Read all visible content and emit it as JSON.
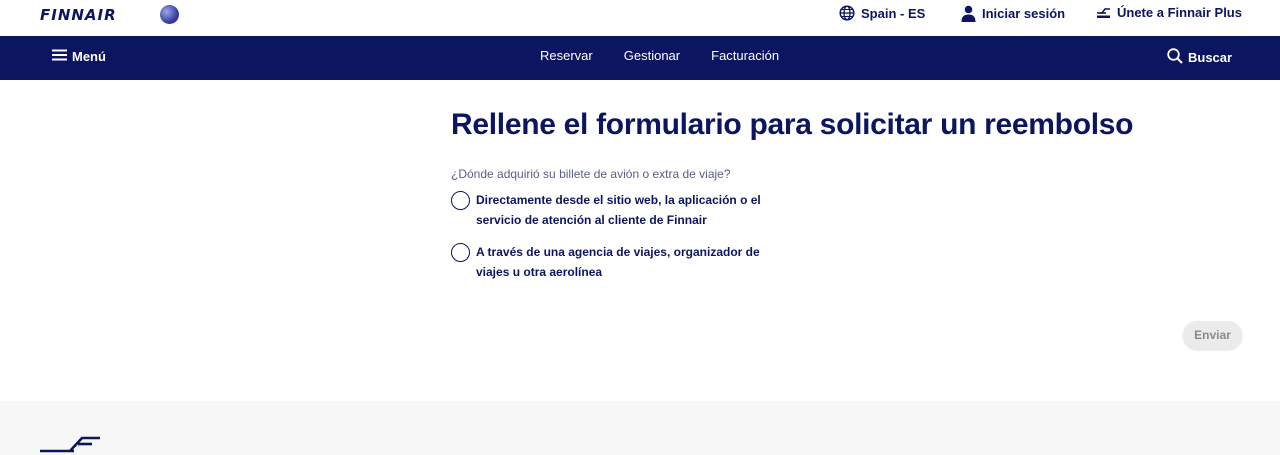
{
  "header": {
    "brand": "FINNAIR",
    "language_label": "Spain - ES",
    "login_label": "Iniciar sesión",
    "plus_label": "Únete a Finnair Plus"
  },
  "nav": {
    "menu_label": "Menú",
    "links": [
      "Reservar",
      "Gestionar",
      "Facturación"
    ],
    "search_label": "Buscar"
  },
  "form": {
    "title": "Rellene el formulario para solicitar un reembolso",
    "question": "¿Dónde adquirió su billete de avión o extra de viaje?",
    "options": [
      {
        "label": "Directamente desde el sitio web, la aplicación o el servicio de atención al cliente de Finnair",
        "selected": false
      },
      {
        "label": "A través de una agencia de viajes, organizador de viajes u otra aerolínea",
        "selected": false
      }
    ],
    "submit_label": "Enviar"
  },
  "colors": {
    "brand_navy": "#0b1560",
    "footer_bg": "#f7f7f7",
    "disabled_button_bg": "#ebebeb"
  },
  "icons": [
    "oneworld-logo",
    "globe-icon",
    "user-icon",
    "finnair-plus-icon",
    "hamburger-icon",
    "search-icon",
    "finnair-footer-logo"
  ]
}
